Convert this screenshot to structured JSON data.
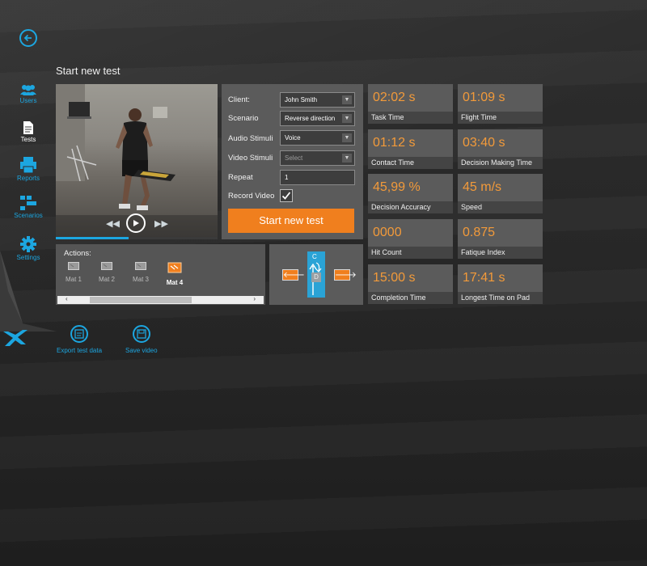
{
  "page": {
    "title": "Start new test"
  },
  "sidebar": {
    "items": [
      {
        "label": "Users",
        "icon": "users-icon"
      },
      {
        "label": "Tests",
        "icon": "tests-icon"
      },
      {
        "label": "Reports",
        "icon": "reports-icon"
      },
      {
        "label": "Scenarios",
        "icon": "scenarios-icon"
      },
      {
        "label": "Settings",
        "icon": "settings-icon"
      }
    ],
    "active": "Tests"
  },
  "video": {
    "progress": 0.45
  },
  "form": {
    "client_label": "Client:",
    "client_value": "John Smith",
    "scenario_label": "Scenario",
    "scenario_value": "Reverse direction",
    "audio_label": "Audio Stimuli",
    "audio_value": "Voice",
    "video_label": "Video Stimuli",
    "video_placeholder": "Select",
    "repeat_label": "Repeat",
    "repeat_value": "1",
    "record_label": "Record Video",
    "record_checked": true,
    "start_button": "Start new test"
  },
  "stats": [
    {
      "value": "02:02 s",
      "label": "Task Time"
    },
    {
      "value": "01:09 s",
      "label": "Flight Time"
    },
    {
      "value": "01:12 s",
      "label": "Contact Time"
    },
    {
      "value": "03:40 s",
      "label": "Decision Making Time"
    },
    {
      "value": "45,99 %",
      "label": "Decision Accuracy"
    },
    {
      "value": "45 m/s",
      "label": "Speed"
    },
    {
      "value": "0000",
      "label": "Hit Count"
    },
    {
      "value": "0.875",
      "label": "Fatique Index"
    },
    {
      "value": "15:00 s",
      "label": "Completion Time"
    },
    {
      "value": "17:41 s",
      "label": "Longest Time on Pad"
    }
  ],
  "actions": {
    "title": "Actions:",
    "mats": [
      {
        "label": "Mat 1"
      },
      {
        "label": "Mat 2"
      },
      {
        "label": "Mat 3"
      },
      {
        "label": "Mat 4"
      }
    ],
    "active_mat": "Mat 4"
  },
  "direction": {
    "top_label": "C",
    "mid_label": "D"
  },
  "bottom_actions": [
    {
      "label": "Export test data",
      "icon": "export-icon"
    },
    {
      "label": "Save video",
      "icon": "save-icon"
    }
  ],
  "colors": {
    "accent": "#1ca6e0",
    "orange": "#f07f1e",
    "panel": "#5b5b5b",
    "value": "#f29a3a"
  }
}
